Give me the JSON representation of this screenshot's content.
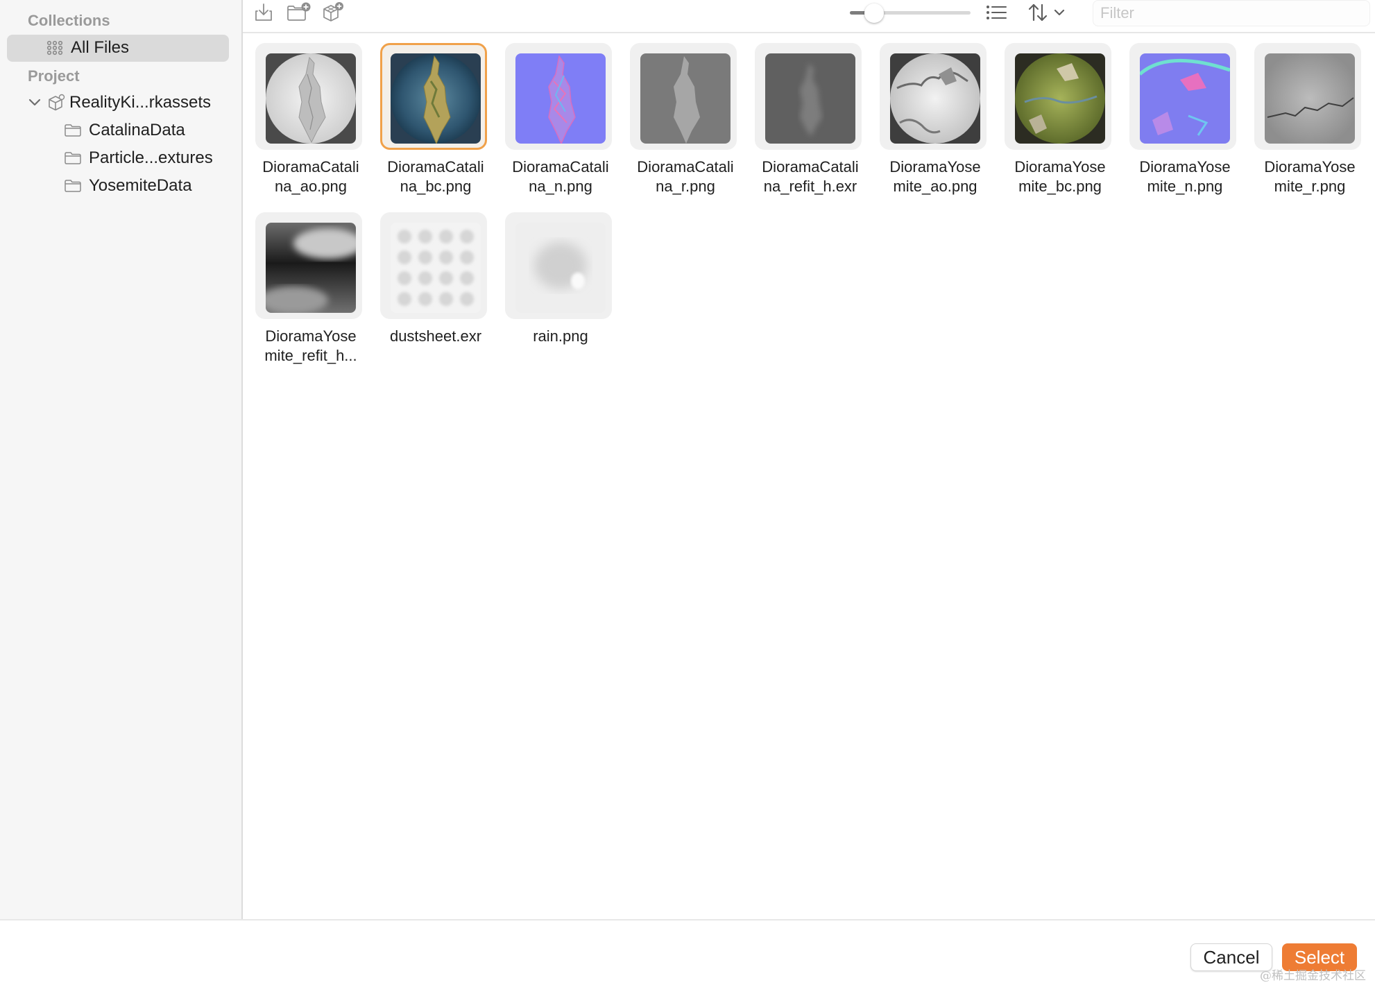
{
  "sidebar": {
    "collections_title": "Collections",
    "all_files_label": "All Files",
    "project_title": "Project",
    "project_name": "RealityKi...rkassets",
    "folders": [
      "CatalinaData",
      "Particle...extures",
      "YosemiteData"
    ]
  },
  "toolbar": {
    "icons": [
      "import-icon",
      "new-folder-icon",
      "add-object-icon",
      "list-view-icon",
      "sort-icon",
      "chevron-down-icon"
    ],
    "thumbnail_size_fraction": 0.2,
    "filter_placeholder": "Filter"
  },
  "files": [
    {
      "name": "DioramaCatalina_ao.png",
      "label": "DioramaCatali\nna_ao.png",
      "selected": false
    },
    {
      "name": "DioramaCatalina_bc.png",
      "label": "DioramaCatali\nna_bc.png",
      "selected": true
    },
    {
      "name": "DioramaCatalina_n.png",
      "label": "DioramaCatali\nna_n.png",
      "selected": false
    },
    {
      "name": "DioramaCatalina_r.png",
      "label": "DioramaCatali\nna_r.png",
      "selected": false
    },
    {
      "name": "DioramaCatalina_refit_h.exr",
      "label": "DioramaCatali\nna_refit_h.exr",
      "selected": false
    },
    {
      "name": "DioramaYosemite_ao.png",
      "label": "DioramaYose\nmite_ao.png",
      "selected": false
    },
    {
      "name": "DioramaYosemite_bc.png",
      "label": "DioramaYose\nmite_bc.png",
      "selected": false
    },
    {
      "name": "DioramaYosemite_n.png",
      "label": "DioramaYose\nmite_n.png",
      "selected": false
    },
    {
      "name": "DioramaYosemite_r.png",
      "label": "DioramaYose\nmite_r.png",
      "selected": false
    },
    {
      "name": "DioramaYosemite_refit_h...",
      "label": "DioramaYose\nmite_refit_h...",
      "selected": false
    },
    {
      "name": "dustsheet.exr",
      "label": "dustsheet.exr",
      "selected": false
    },
    {
      "name": "rain.png",
      "label": "rain.png",
      "selected": false
    }
  ],
  "footer": {
    "cancel_label": "Cancel",
    "select_label": "Select"
  },
  "colors": {
    "accent": "#ee7c34",
    "selection_border": "#f0a14a"
  },
  "watermark": "@稀土掘金技术社区"
}
